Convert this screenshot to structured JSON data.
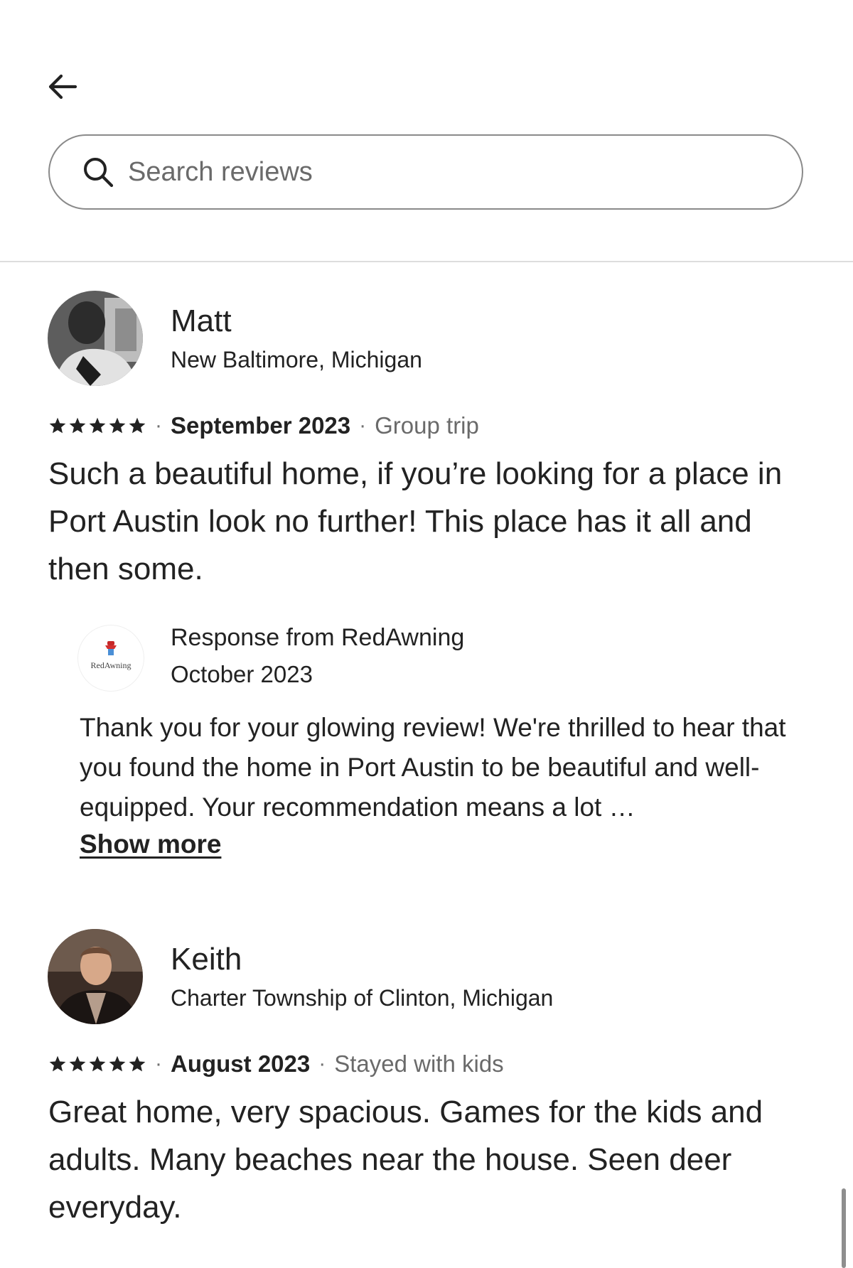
{
  "header": {
    "back_icon": "arrow-left-icon"
  },
  "search": {
    "placeholder": "Search reviews",
    "value": "",
    "icon": "search-icon"
  },
  "reviews": [
    {
      "name": "Matt",
      "location": "New Baltimore, Michigan",
      "rating": 5,
      "date": "September 2023",
      "trip_type": "Group trip",
      "text": "Such a beautiful home, if you’re looking for a place in Port Austin look no further! This place has it all and then some.",
      "response": {
        "title": "Response from RedAwning",
        "logo_text": "RedAwning",
        "date": "October 2023",
        "text": "Thank you for your glowing review! We're thrilled to hear that you found the home in Port Austin to be beautiful and well-equipped. Your recommendation means a lot …",
        "show_more": "Show more"
      }
    },
    {
      "name": "Keith",
      "location": "Charter Township of Clinton, Michigan",
      "rating": 5,
      "date": "August 2023",
      "trip_type": "Stayed with kids",
      "text": "Great home, very spacious. Games for the kids and adults. Many beaches near the house. Seen deer everyday."
    }
  ],
  "colors": {
    "text": "#222222",
    "muted": "#6a6a6a",
    "border": "#8a8a8a",
    "divider": "#dddddd"
  }
}
